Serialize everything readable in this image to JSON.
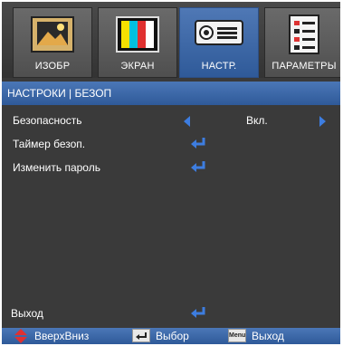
{
  "tabs": [
    {
      "label": "ИЗОБР",
      "icon": "image-icon",
      "active": false
    },
    {
      "label": "ЭКРАН",
      "icon": "color-bars-icon",
      "active": false
    },
    {
      "label": "НАСТР.",
      "icon": "projector-icon",
      "active": true
    },
    {
      "label": "ПАРАМЕТРЫ",
      "icon": "checklist-icon",
      "active": false
    }
  ],
  "title": "НАСТРОКИ | БЕЗОП",
  "menu": {
    "security": {
      "label": "Безопасность",
      "value": "Вкл."
    },
    "timer": {
      "label": "Таймер безоп."
    },
    "change_password": {
      "label": "Изменить пароль"
    },
    "exit": {
      "label": "Выход"
    }
  },
  "footer": {
    "updown": "ВверхВниз",
    "select": "Выбор",
    "menu_key": "Menu",
    "exit": "Выход"
  },
  "colors": {
    "accent": "#3d7de0",
    "tab_active": "#3b67a8",
    "background": "#3a3a3a"
  }
}
